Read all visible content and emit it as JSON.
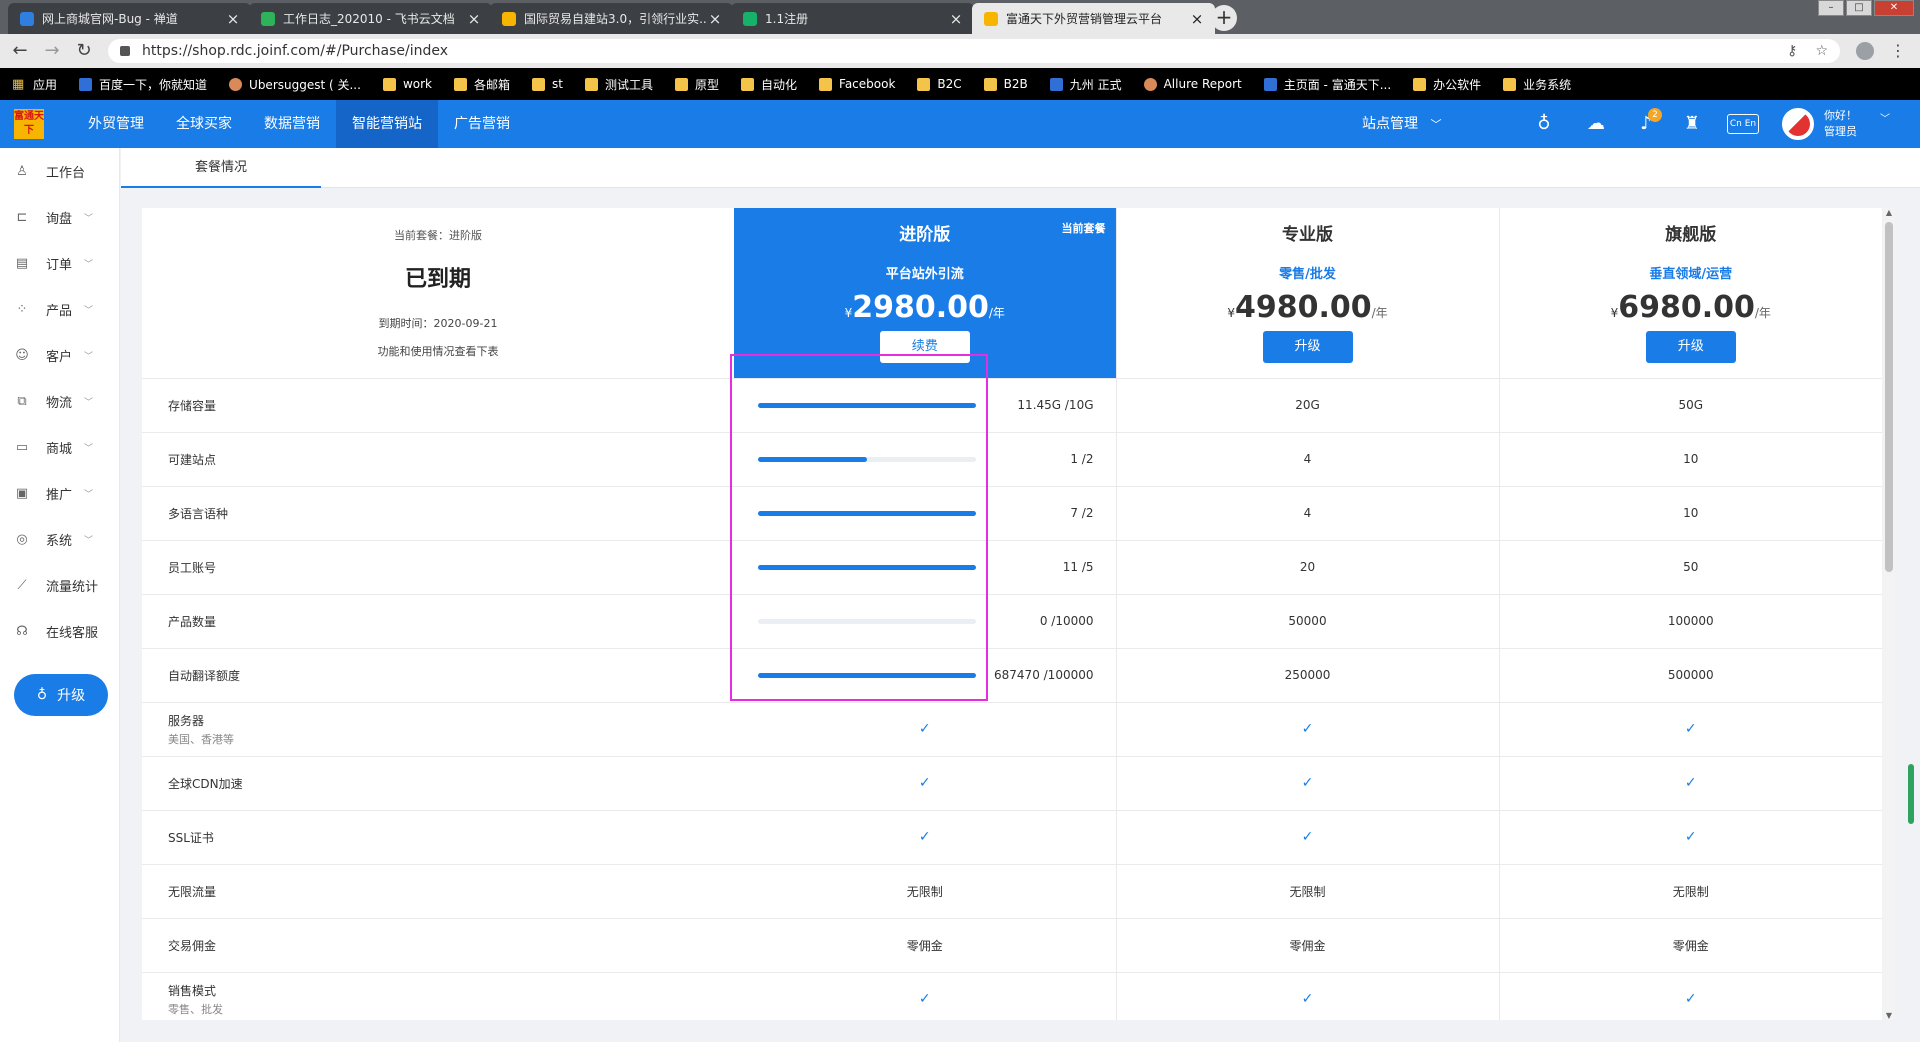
{
  "browser": {
    "tabs": [
      {
        "title": "网上商城官网-Bug - 禅道",
        "color": "#2f7fe0"
      },
      {
        "title": "工作日志_202010 - 飞书云文档",
        "color": "#2fb35a"
      },
      {
        "title": "国际贸易自建站3.0，引领行业实...",
        "color": "#f7b500"
      },
      {
        "title": "1.1注册",
        "color": "#17b26a"
      },
      {
        "title": "富通天下外贸营销管理云平台",
        "color": "#f7b500"
      }
    ],
    "tab_close": "×",
    "new_tab": "+",
    "url": "https://shop.rdc.joinf.com/#/Purchase/index",
    "bookmarks": [
      "应用",
      "百度一下，你就知道",
      "Ubersuggest ( 关...",
      "work",
      "各邮箱",
      "st",
      "测试工具",
      "原型",
      "自动化",
      "Facebook",
      "B2C",
      "B2B",
      "九州 正式",
      "Allure Report",
      "主页面 - 富通天下...",
      "办公软件",
      "业务系统"
    ]
  },
  "header": {
    "logo_text": "富通天下",
    "nav": [
      "外贸管理",
      "全球买家",
      "数据营销",
      "智能营销站",
      "广告营销"
    ],
    "active_nav_index": 3,
    "site_mgmt": "站点管理",
    "notification_count": "2",
    "lang": "Cn En",
    "greeting": "你好！",
    "role": "管理员"
  },
  "sidebar": {
    "items": [
      {
        "label": "工作台",
        "icon": "person-icon",
        "glyph": "♙",
        "caret": false
      },
      {
        "label": "询盘",
        "icon": "cart-icon",
        "glyph": "⊏",
        "caret": true
      },
      {
        "label": "订单",
        "icon": "order-icon",
        "glyph": "▤",
        "caret": true
      },
      {
        "label": "产品",
        "icon": "product-icon",
        "glyph": "⁘",
        "caret": true
      },
      {
        "label": "客户",
        "icon": "customer-icon",
        "glyph": "☺",
        "caret": true
      },
      {
        "label": "物流",
        "icon": "logistics-icon",
        "glyph": "⧉",
        "caret": true
      },
      {
        "label": "商城",
        "icon": "mall-icon",
        "glyph": "▭",
        "caret": true
      },
      {
        "label": "推广",
        "icon": "promo-icon",
        "glyph": "▣",
        "caret": true
      },
      {
        "label": "系统",
        "icon": "system-icon",
        "glyph": "◎",
        "caret": true
      },
      {
        "label": "流量统计",
        "icon": "chart-icon",
        "glyph": "⟋",
        "caret": false
      },
      {
        "label": "在线客服",
        "icon": "headset-icon",
        "glyph": "☊",
        "caret": false
      }
    ],
    "upgrade_label": "升级"
  },
  "subtab": "套餐情况",
  "current": {
    "label": "当前套餐：进阶版",
    "status": "已到期",
    "expire": "到期时间：2020-09-21",
    "note": "功能和使用情况查看下表"
  },
  "plans": [
    {
      "name": "进阶版",
      "sub": "平台站外引流",
      "currency": "¥",
      "price": "2980.00",
      "unit": "/年",
      "button": "续费",
      "current": true,
      "tag": "当前套餐"
    },
    {
      "name": "专业版",
      "sub": "零售/批发",
      "currency": "¥",
      "price": "4980.00",
      "unit": "/年",
      "button": "升级",
      "current": false,
      "tag": ""
    },
    {
      "name": "旗舰版",
      "sub": "垂直领域/运营",
      "currency": "¥",
      "price": "6980.00",
      "unit": "/年",
      "button": "升级",
      "current": false,
      "tag": ""
    }
  ],
  "usage_rows": [
    {
      "label": "存储容量",
      "used": "11.45G /10G",
      "fill": 1.0,
      "pro": "20G",
      "flag": "50G"
    },
    {
      "label": "可建站点",
      "used": "1 /2",
      "fill": 0.5,
      "pro": "4",
      "flag": "10"
    },
    {
      "label": "多语言语种",
      "used": "7 /2",
      "fill": 1.0,
      "pro": "4",
      "flag": "10"
    },
    {
      "label": "员工账号",
      "used": "11 /5",
      "fill": 1.0,
      "pro": "20",
      "flag": "50"
    },
    {
      "label": "产品数量",
      "used": "0 /10000",
      "fill": 0.0,
      "pro": "50000",
      "flag": "100000"
    },
    {
      "label": "自动翻译额度",
      "used": "687470 /100000",
      "fill": 1.0,
      "pro": "250000",
      "flag": "500000"
    }
  ],
  "feature_rows": [
    {
      "label": "服务器",
      "sub": "美国、香港等",
      "values": [
        "✓",
        "✓",
        "✓"
      ],
      "type": "check"
    },
    {
      "label": "全球CDN加速",
      "sub": "",
      "values": [
        "✓",
        "✓",
        "✓"
      ],
      "type": "check"
    },
    {
      "label": "SSL证书",
      "sub": "",
      "values": [
        "✓",
        "✓",
        "✓"
      ],
      "type": "check"
    },
    {
      "label": "无限流量",
      "sub": "",
      "values": [
        "无限制",
        "无限制",
        "无限制"
      ],
      "type": "text"
    },
    {
      "label": "交易佣金",
      "sub": "",
      "values": [
        "零佣金",
        "零佣金",
        "零佣金"
      ],
      "type": "text"
    },
    {
      "label": "销售模式",
      "sub": "零售、批发",
      "values": [
        "✓",
        "✓",
        "✓"
      ],
      "type": "check"
    }
  ],
  "colors": {
    "primary": "#1a7ce6",
    "highlight": "#e52ee0"
  }
}
